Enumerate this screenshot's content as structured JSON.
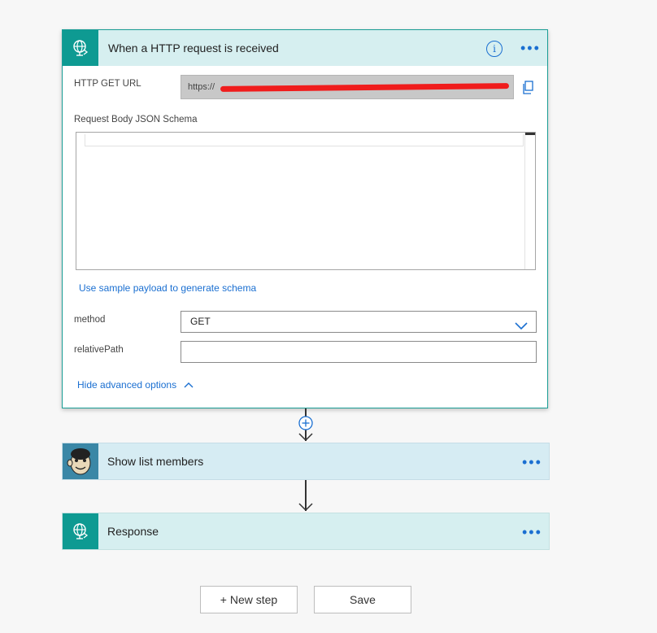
{
  "trigger": {
    "title": "When a HTTP request is received",
    "info_icon": "info-icon",
    "more_icon": "more-dots-icon",
    "url_label": "HTTP GET URL",
    "url_value": "https://",
    "schema_label": "Request Body JSON Schema",
    "schema_value": "",
    "sample_link": "Use sample payload to generate schema",
    "method_label": "method",
    "method_value": "GET",
    "relative_label": "relativePath",
    "relative_value": "",
    "hide_link": "Hide advanced options"
  },
  "steps": [
    {
      "title": "Show list members",
      "icon": "mailchimp-icon"
    },
    {
      "title": "Response",
      "icon": "http-globe-icon"
    }
  ],
  "buttons": {
    "new_step": "+ New step",
    "save": "Save"
  },
  "colors": {
    "accent": "#0e9a92",
    "header_bg": "#d6eff0",
    "link": "#1a6fd1",
    "redaction": "#f01c1c"
  }
}
